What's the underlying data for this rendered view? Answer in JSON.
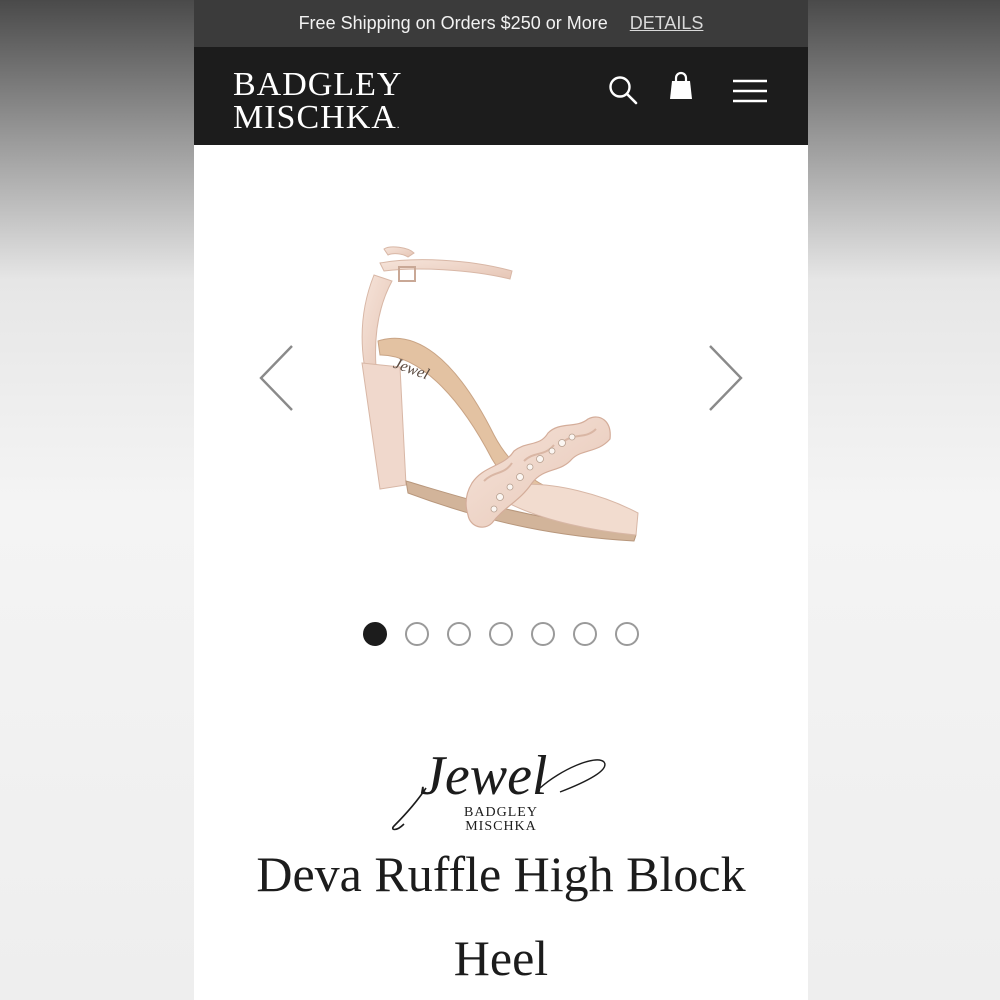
{
  "promo": {
    "text": "Free Shipping on Orders $250 or More",
    "link": "DETAILS"
  },
  "header": {
    "logo_line1": "BADGLEY",
    "logo_line2": "MISCHKA",
    "logo_mark": ".",
    "icons": [
      "search-icon",
      "shopping-bag-icon",
      "menu-icon"
    ]
  },
  "gallery": {
    "image_count": 7,
    "active_index": 0,
    "prev_icon": "chevron-left-icon",
    "next_icon": "chevron-right-icon",
    "insole_script": "Jewel"
  },
  "product": {
    "brand_script": "Jewel",
    "brand_line1": "BADGLEY",
    "brand_line2": "MISCHKA",
    "title": "Deva Ruffle High Block Heel"
  },
  "colors": {
    "promo_bg": "#3b3b3b",
    "header_bg": "#1c1c1c",
    "shoe_satin": "#f0d8cc",
    "dot_active": "#1c1c1c"
  }
}
